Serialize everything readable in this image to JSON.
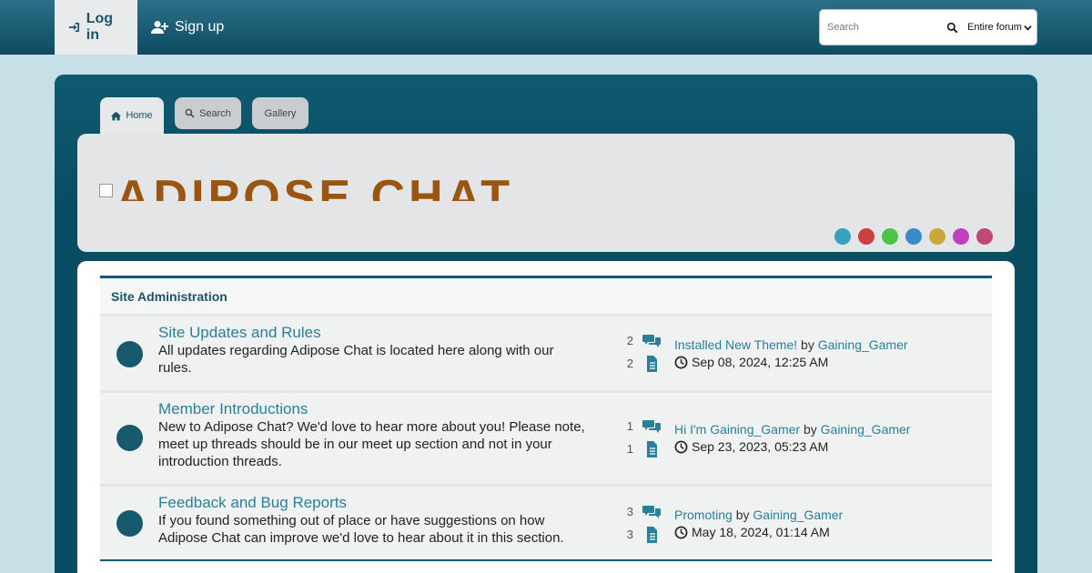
{
  "topnav": {
    "login_label": "Log in",
    "signup_label": "Sign up"
  },
  "search": {
    "placeholder": "Search",
    "scope": "Entire forum"
  },
  "tabs": [
    {
      "label": "Home",
      "icon": "home-icon"
    },
    {
      "label": "Search",
      "icon": "search-icon"
    },
    {
      "label": "Gallery"
    }
  ],
  "banner": {
    "logo_text": "ADIPOSE CHAT",
    "swatches": [
      "#3aa0c0",
      "#c94040",
      "#4cc44c",
      "#3a8cc8",
      "#c8a838",
      "#c040c0",
      "#c04878"
    ]
  },
  "section": {
    "title": "Site Administration",
    "forums": [
      {
        "title": "Site Updates and Rules",
        "description": "All updates regarding Adipose Chat is located here along with our rules.",
        "topics": "2",
        "posts": "2",
        "last_post_title": "Installed New Theme!",
        "by": "by",
        "last_post_author": "Gaining_Gamer",
        "last_post_date": "Sep 08, 2024, 12:25 AM"
      },
      {
        "title": "Member Introductions",
        "description": "New to Adipose Chat? We'd love to hear more about you! Please note, meet up threads should be in our meet up section and not in your introduction threads.",
        "topics": "1",
        "posts": "1",
        "last_post_title": "Hi I'm Gaining_Gamer",
        "by": "by",
        "last_post_author": "Gaining_Gamer",
        "last_post_date": "Sep 23, 2023, 05:23 AM"
      },
      {
        "title": "Feedback and Bug Reports",
        "description": "If you found something out of place or have suggestions on how Adipose Chat can improve we'd love to hear about it in this section.",
        "topics": "3",
        "posts": "3",
        "last_post_title": "Promoting",
        "by": "by",
        "last_post_author": "Gaining_Gamer",
        "last_post_date": "May 18, 2024, 01:14 AM"
      }
    ]
  },
  "colors": {
    "accent": "#0f5a70",
    "link": "#2a7f99",
    "background": "#c7dfe7"
  }
}
